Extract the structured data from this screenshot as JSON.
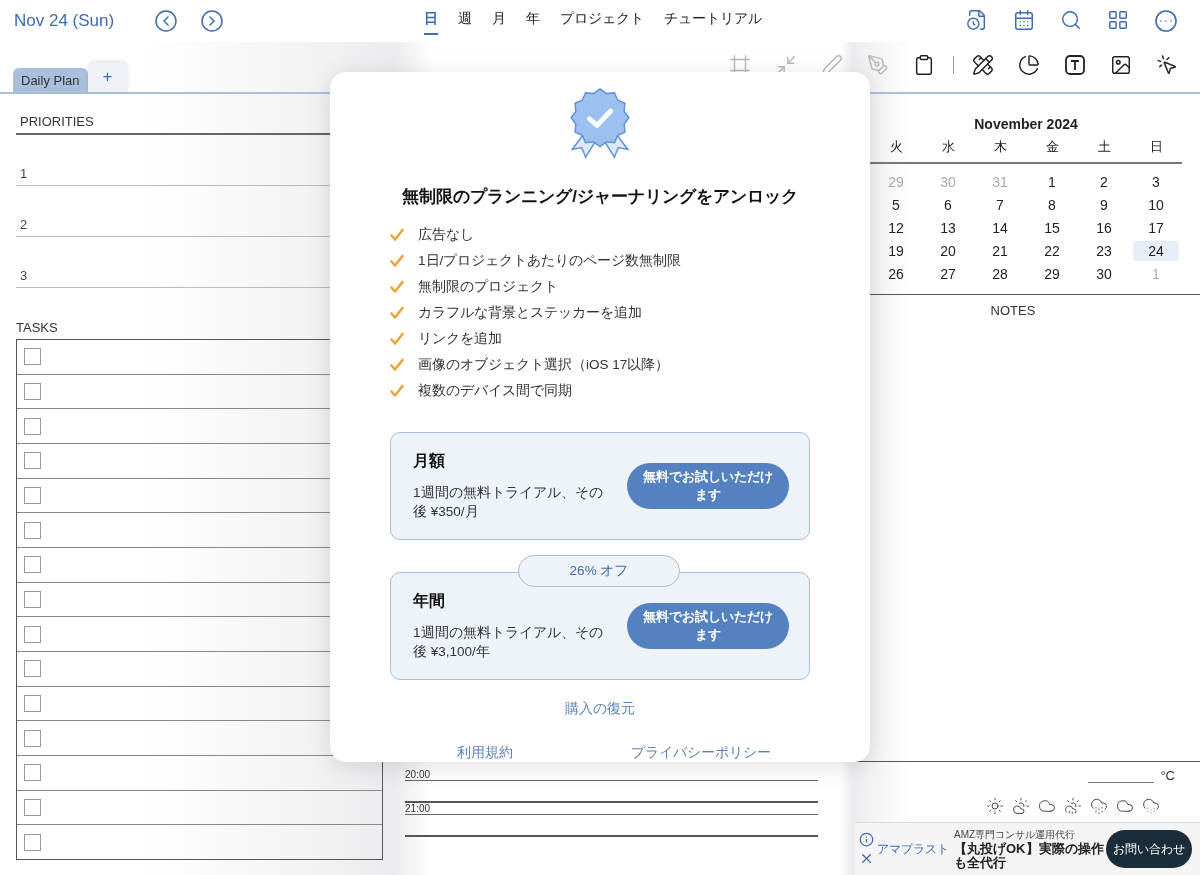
{
  "header": {
    "date": "Nov 24 (Sun)",
    "views": [
      {
        "label": "日",
        "selected": true
      },
      {
        "label": "週",
        "selected": false
      },
      {
        "label": "月",
        "selected": false
      },
      {
        "label": "年",
        "selected": false
      },
      {
        "label": "プロジェクト",
        "selected": false
      },
      {
        "label": "チュートリアル",
        "selected": false
      }
    ]
  },
  "page_tabs": [
    {
      "label": "Daily Plan",
      "selected": true
    }
  ],
  "add_tab": "+",
  "toolbar": [
    {
      "disabled": true
    },
    {
      "disabled": true
    },
    {
      "disabled": true
    },
    {
      "disabled": true
    },
    {
      "disabled": false
    },
    {
      "disabled": false
    },
    {
      "disabled": false
    },
    {
      "disabled": false
    },
    {
      "disabled": false
    },
    {
      "disabled": false
    }
  ],
  "priorities": {
    "title": "PRIORITIES",
    "items": [
      "1",
      "2",
      "3"
    ]
  },
  "tasks": {
    "title": "TASKS",
    "rows": [
      {
        "checked": false
      },
      {
        "checked": false
      },
      {
        "checked": false
      },
      {
        "checked": false
      },
      {
        "checked": false
      },
      {
        "checked": false
      },
      {
        "checked": false
      },
      {
        "checked": false
      },
      {
        "checked": false
      },
      {
        "checked": false
      },
      {
        "checked": false
      },
      {
        "checked": false
      },
      {
        "checked": false
      },
      {
        "checked": false
      },
      {
        "checked": false
      }
    ]
  },
  "schedule": {
    "times": [
      "20:00",
      "21:00"
    ]
  },
  "calendar": {
    "title": "November 2024",
    "weekdays": [
      "火",
      "水",
      "木",
      "金",
      "土",
      "日"
    ],
    "weeks": [
      [
        {
          "day": "29",
          "outside": true,
          "selected": false
        },
        {
          "day": "30",
          "outside": true,
          "selected": false
        },
        {
          "day": "31",
          "outside": true,
          "selected": false
        },
        {
          "day": "1",
          "outside": false,
          "selected": false
        },
        {
          "day": "2",
          "outside": false,
          "selected": false
        },
        {
          "day": "3",
          "outside": false,
          "selected": false
        }
      ],
      [
        {
          "day": "5",
          "outside": false,
          "selected": false
        },
        {
          "day": "6",
          "outside": false,
          "selected": false
        },
        {
          "day": "7",
          "outside": false,
          "selected": false
        },
        {
          "day": "8",
          "outside": false,
          "selected": false
        },
        {
          "day": "9",
          "outside": false,
          "selected": false
        },
        {
          "day": "10",
          "outside": false,
          "selected": false
        }
      ],
      [
        {
          "day": "12",
          "outside": false,
          "selected": false
        },
        {
          "day": "13",
          "outside": false,
          "selected": false
        },
        {
          "day": "14",
          "outside": false,
          "selected": false
        },
        {
          "day": "15",
          "outside": false,
          "selected": false
        },
        {
          "day": "16",
          "outside": false,
          "selected": false
        },
        {
          "day": "17",
          "outside": false,
          "selected": false
        }
      ],
      [
        {
          "day": "19",
          "outside": false,
          "selected": false
        },
        {
          "day": "20",
          "outside": false,
          "selected": false
        },
        {
          "day": "21",
          "outside": false,
          "selected": false
        },
        {
          "day": "22",
          "outside": false,
          "selected": false
        },
        {
          "day": "23",
          "outside": false,
          "selected": false
        },
        {
          "day": "24",
          "outside": false,
          "selected": true
        }
      ],
      [
        {
          "day": "26",
          "outside": false,
          "selected": false
        },
        {
          "day": "27",
          "outside": false,
          "selected": false
        },
        {
          "day": "28",
          "outside": false,
          "selected": false
        },
        {
          "day": "29",
          "outside": false,
          "selected": false
        },
        {
          "day": "30",
          "outside": false,
          "selected": false
        },
        {
          "day": "1",
          "outside": true,
          "selected": false
        }
      ]
    ]
  },
  "notes": {
    "title": "NOTES"
  },
  "weather": {
    "unit": "°C"
  },
  "modal": {
    "title": "無制限のプランニング/ジャーナリングをアンロック",
    "features": [
      "広告なし",
      "1日/プロジェクトあたりのページ数無制限",
      "無制限のプロジェクト",
      "カラフルな背景とステッカーを追加",
      "リンクを追加",
      "画像のオブジェクト選択（iOS 17以降）",
      "複数のデバイス間で同期"
    ],
    "plans": [
      {
        "name": "月額",
        "description": "1週間の無料トライアル、その後 ¥350/月",
        "button": "無料でお試しいただけます"
      },
      {
        "name": "年間",
        "badge": "26% オフ",
        "description": "1週間の無料トライアル、その後 ¥3,100/年",
        "button": "無料でお試しいただけます"
      }
    ],
    "restore": "購入の復元",
    "links": [
      "利用規約",
      "プライバシーポリシー"
    ]
  },
  "ad": {
    "brand": "アマプラスト",
    "sponsor": "AMZ専門コンサル運用代行",
    "headline": "【丸投げOK】実際の操作も全代行",
    "button": "お問い合わせ"
  }
}
